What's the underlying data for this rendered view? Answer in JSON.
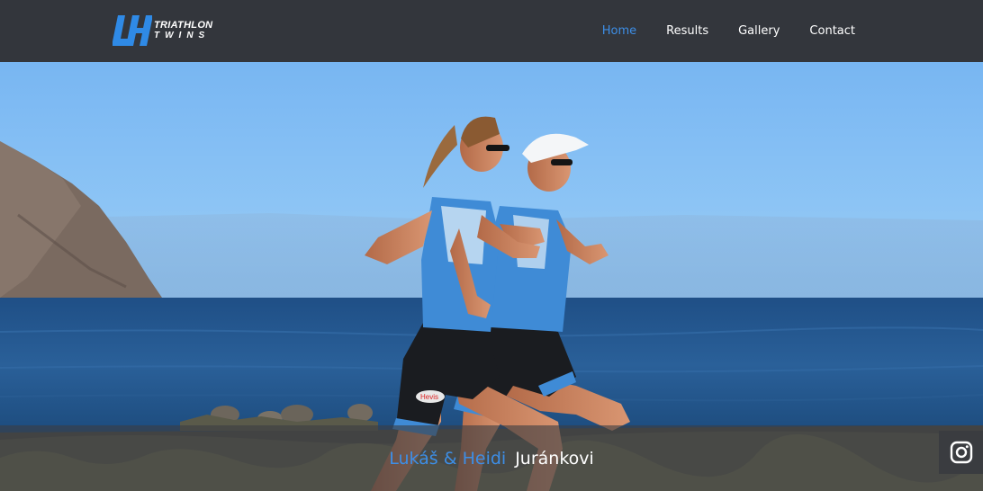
{
  "logo": {
    "mark": "LH",
    "line1": "TRIATHLON",
    "line2": "TWINS"
  },
  "nav": {
    "items": [
      {
        "label": "Home",
        "active": true
      },
      {
        "label": "Results",
        "active": false
      },
      {
        "label": "Gallery",
        "active": false
      },
      {
        "label": "Contact",
        "active": false
      }
    ]
  },
  "hero": {
    "first_names": "Lukáš & Heidi",
    "surname": "Juránkovi"
  },
  "social": {
    "icon": "instagram-icon"
  },
  "colors": {
    "accent": "#3d8ee6",
    "navbar": "#33363c",
    "text": "#ffffff"
  }
}
